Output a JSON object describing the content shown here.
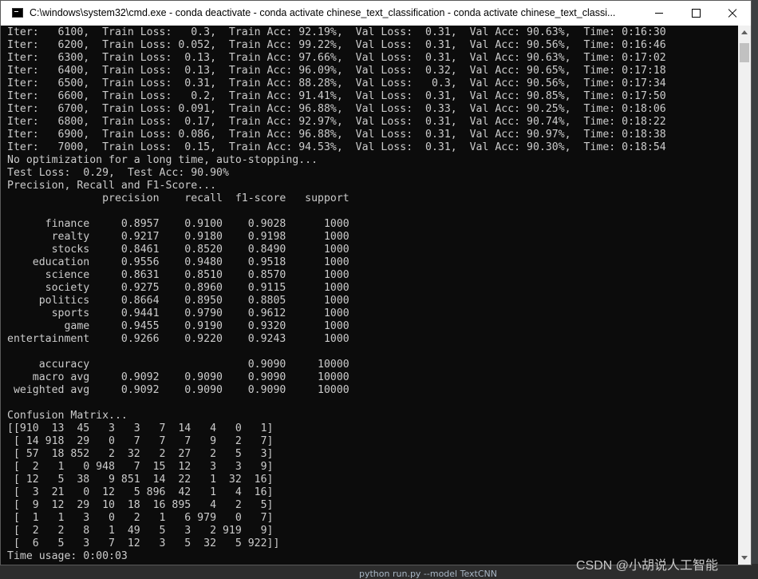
{
  "window": {
    "title": "C:\\windows\\system32\\cmd.exe - conda  deactivate - conda  activate chinese_text_classification - conda  activate chinese_text_classi..."
  },
  "console_lines": [
    "Iter:   6100,  Train Loss:   0.3,  Train Acc: 92.19%,  Val Loss:  0.31,  Val Acc: 90.63%,  Time: 0:16:30",
    "Iter:   6200,  Train Loss: 0.052,  Train Acc: 99.22%,  Val Loss:  0.31,  Val Acc: 90.56%,  Time: 0:16:46",
    "Iter:   6300,  Train Loss:  0.13,  Train Acc: 97.66%,  Val Loss:  0.31,  Val Acc: 90.63%,  Time: 0:17:02",
    "Iter:   6400,  Train Loss:  0.13,  Train Acc: 96.09%,  Val Loss:  0.32,  Val Acc: 90.65%,  Time: 0:17:18",
    "Iter:   6500,  Train Loss:  0.31,  Train Acc: 88.28%,  Val Loss:   0.3,  Val Acc: 90.56%,  Time: 0:17:34",
    "Iter:   6600,  Train Loss:   0.2,  Train Acc: 91.41%,  Val Loss:  0.31,  Val Acc: 90.85%,  Time: 0:17:50",
    "Iter:   6700,  Train Loss: 0.091,  Train Acc: 96.88%,  Val Loss:  0.33,  Val Acc: 90.25%,  Time: 0:18:06",
    "Iter:   6800,  Train Loss:  0.17,  Train Acc: 92.97%,  Val Loss:  0.31,  Val Acc: 90.74%,  Time: 0:18:22",
    "Iter:   6900,  Train Loss: 0.086,  Train Acc: 96.88%,  Val Loss:  0.31,  Val Acc: 90.97%,  Time: 0:18:38",
    "Iter:   7000,  Train Loss:  0.15,  Train Acc: 94.53%,  Val Loss:  0.31,  Val Acc: 90.30%,  Time: 0:18:54",
    "No optimization for a long time, auto-stopping...",
    "Test Loss:  0.29,  Test Acc: 90.90%",
    "Precision, Recall and F1-Score...",
    "               precision    recall  f1-score   support",
    "",
    "      finance     0.8957    0.9100    0.9028      1000",
    "       realty     0.9217    0.9180    0.9198      1000",
    "       stocks     0.8461    0.8520    0.8490      1000",
    "    education     0.9556    0.9480    0.9518      1000",
    "      science     0.8631    0.8510    0.8570      1000",
    "      society     0.9275    0.8960    0.9115      1000",
    "     politics     0.8664    0.8950    0.8805      1000",
    "       sports     0.9441    0.9790    0.9612      1000",
    "         game     0.9455    0.9190    0.9320      1000",
    "entertainment     0.9266    0.9220    0.9243      1000",
    "",
    "     accuracy                         0.9090     10000",
    "    macro avg     0.9092    0.9090    0.9090     10000",
    " weighted avg     0.9092    0.9090    0.9090     10000",
    "",
    "Confusion Matrix...",
    "[[910  13  45   3   3   7  14   4   0   1]",
    " [ 14 918  29   0   7   7   7   9   2   7]",
    " [ 57  18 852   2  32   2  27   2   5   3]",
    " [  2   1   0 948   7  15  12   3   3   9]",
    " [ 12   5  38   9 851  14  22   1  32  16]",
    " [  3  21   0  12   5 896  42   1   4  16]",
    " [  9  12  29  10  18  16 895   4   2   5]",
    " [  1   1   3   0   2   1   6 979   0   7]",
    " [  2   2   8   1  49   5   3   2 919   9]",
    " [  6   5   3   7  12   3   5  32   5 922]]",
    "Time usage: 0:00:03"
  ],
  "watermark": "CSDN @小胡说人工智能",
  "background_window_text": "python run.py --model TextCNN",
  "colors": {
    "console_bg": "#0c0c0c",
    "console_fg": "#cccccc",
    "titlebar_bg": "#ffffff"
  }
}
